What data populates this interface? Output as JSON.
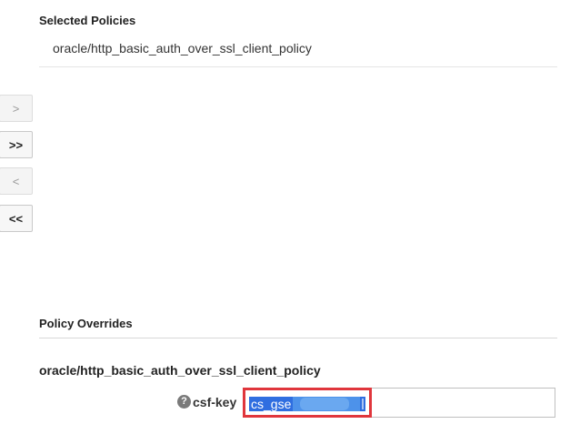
{
  "selected_policies": {
    "heading": "Selected Policies",
    "items": [
      "oracle/http_basic_auth_over_ssl_client_policy"
    ]
  },
  "shuttle": {
    "move_label": ">",
    "move_all_label": ">>",
    "remove_label": "<",
    "remove_all_label": "<<"
  },
  "policy_overrides": {
    "heading": "Policy Overrides",
    "policy_name": "oracle/http_basic_auth_over_ssl_client_policy",
    "help_glyph": "?",
    "field_label": "csf-key",
    "field_value": "cs_gse"
  },
  "colors": {
    "highlight_border": "#e0363c",
    "selection": "#2f6ee0"
  }
}
